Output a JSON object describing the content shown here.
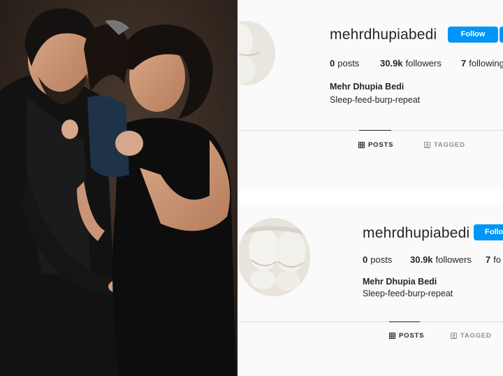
{
  "profiles": [
    {
      "username": "mehrdhupiabedi",
      "follow_label": "Follow",
      "posts_count": "0",
      "posts_label": "posts",
      "followers_count": "30.9k",
      "followers_label": "followers",
      "following_count": "7",
      "following_label": "following",
      "full_name": "Mehr Dhupia Bedi",
      "bio": "Sleep-feed-burp-repeat",
      "tabs": [
        {
          "label": "POSTS",
          "icon": "grid-icon",
          "active": true
        },
        {
          "label": "TAGGED",
          "icon": "tagged-icon",
          "active": false
        }
      ]
    },
    {
      "username": "mehrdhupiabedi",
      "follow_label": "Follow",
      "posts_count": "0",
      "posts_label": "posts",
      "followers_count": "30.9k",
      "followers_label": "followers",
      "following_count": "7",
      "following_label": "fo",
      "full_name": "Mehr Dhupia Bedi",
      "bio": "Sleep-feed-burp-repeat",
      "tabs": [
        {
          "label": "POSTS",
          "icon": "grid-icon",
          "active": true
        },
        {
          "label": "TAGGED",
          "icon": "tagged-icon",
          "active": false
        }
      ]
    }
  ],
  "colors": {
    "follow_button": "#0095f6",
    "text": "#262626",
    "muted": "#8e8e8e",
    "border": "#dbdbdb"
  }
}
